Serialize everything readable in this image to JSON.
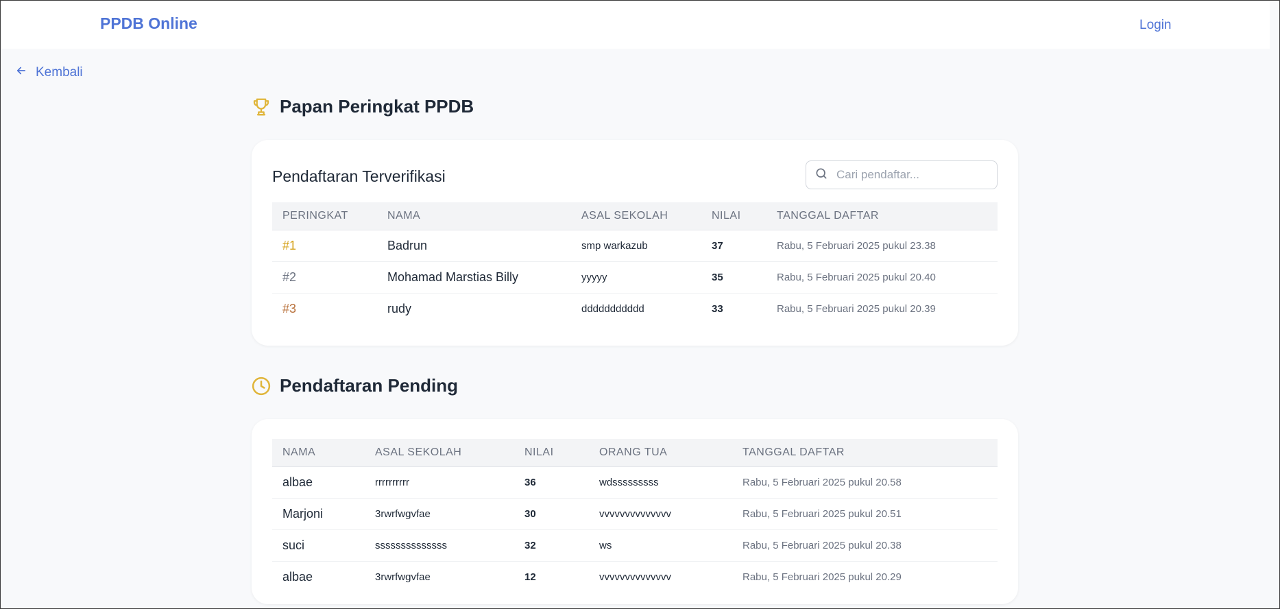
{
  "header": {
    "brand": "PPDB Online",
    "login_label": "Login"
  },
  "back": {
    "label": "Kembali"
  },
  "leaderboard": {
    "title": "Papan Peringkat PPDB",
    "card_title": "Pendaftaran Terverifikasi",
    "search_placeholder": "Cari pendaftar...",
    "columns": [
      "PERINGKAT",
      "NAMA",
      "ASAL SEKOLAH",
      "NILAI",
      "TANGGAL DAFTAR"
    ],
    "rows": [
      {
        "rank": "#1",
        "rank_color": "#d4a017",
        "name": "Badrun",
        "school": "smp warkazub",
        "score": "37",
        "date": "Rabu, 5 Februari 2025 pukul 23.38"
      },
      {
        "rank": "#2",
        "rank_color": "#6b7280",
        "name": "Mohamad Marstias Billy",
        "school": "yyyyy",
        "score": "35",
        "date": "Rabu, 5 Februari 2025 pukul 20.40"
      },
      {
        "rank": "#3",
        "rank_color": "#b8703a",
        "name": "rudy",
        "school": "ddddddddddd",
        "score": "33",
        "date": "Rabu, 5 Februari 2025 pukul 20.39"
      }
    ]
  },
  "pending": {
    "title": "Pendaftaran Pending",
    "columns": [
      "NAMA",
      "ASAL SEKOLAH",
      "NILAI",
      "ORANG TUA",
      "TANGGAL DAFTAR"
    ],
    "rows": [
      {
        "name": "albae",
        "school": "rrrrrrrrrr",
        "score": "36",
        "parent": "wdsssssssss",
        "date": "Rabu, 5 Februari 2025 pukul 20.58"
      },
      {
        "name": "Marjoni",
        "school": "3rwrfwgvfae",
        "score": "30",
        "parent": "vvvvvvvvvvvvvv",
        "date": "Rabu, 5 Februari 2025 pukul 20.51"
      },
      {
        "name": "suci",
        "school": "ssssssssssssss",
        "score": "32",
        "parent": "ws",
        "date": "Rabu, 5 Februari 2025 pukul 20.38"
      },
      {
        "name": "albae",
        "school": "3rwrfwgvfae",
        "score": "12",
        "parent": "vvvvvvvvvvvvvv",
        "date": "Rabu, 5 Februari 2025 pukul 20.29"
      }
    ]
  },
  "colors": {
    "accent": "#4f74d6",
    "icon_gold": "#e0b53a"
  },
  "icons": {
    "back": "arrow-left-icon",
    "trophy": "trophy-icon",
    "clock": "clock-icon",
    "search": "search-icon"
  }
}
